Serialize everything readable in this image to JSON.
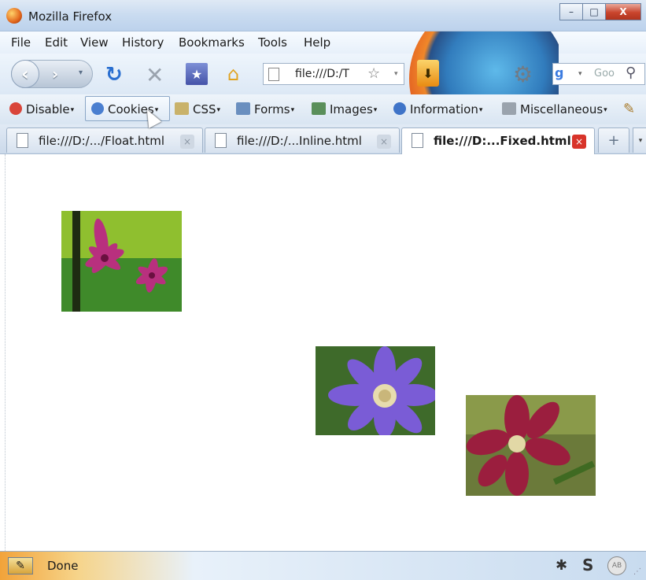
{
  "window": {
    "title": "Mozilla Firefox",
    "minimize": "–",
    "maximize": "□",
    "close": "X"
  },
  "menu": {
    "items": [
      "File",
      "Edit",
      "View",
      "History",
      "Bookmarks",
      "Tools",
      "Help"
    ]
  },
  "nav": {
    "back": "‹",
    "forward": "›",
    "dropdown": "▾",
    "reload": "↻",
    "stop": "✕",
    "bookmark": "★",
    "home": "⌂",
    "url": "file:///D:/T",
    "url_star": "☆",
    "url_drop": "▾",
    "download": "⬇",
    "settings": "⚙",
    "search_engine": "g",
    "search_drop": "▾",
    "search_placeholder": "Goo",
    "search_go": "⚲"
  },
  "devtoolbar": {
    "items": [
      {
        "label": "Disable",
        "color": "#d9453a"
      },
      {
        "label": "Cookies",
        "color": "#4a7fd0"
      },
      {
        "label": "CSS",
        "color": "#c9b26a"
      },
      {
        "label": "Forms",
        "color": "#6a8fbf"
      },
      {
        "label": "Images",
        "color": "#5a8f5a"
      },
      {
        "label": "Information",
        "color": "#3f74c8"
      },
      {
        "label": "Miscellaneous",
        "color": "#9aa3ad"
      }
    ],
    "arrow": "▾",
    "pen": "✎"
  },
  "tabs": [
    {
      "label": "file:///D:/.../Float.html",
      "active": false
    },
    {
      "label": "file:///D:/...Inline.html",
      "active": false
    },
    {
      "label": "file:///D:...Fixed.html",
      "active": true
    }
  ],
  "tab_close": "×",
  "new_tab": "+",
  "tab_list": "▾",
  "status": {
    "icon": "✎",
    "text": "Done",
    "bug": "✱",
    "s": "S",
    "adblock": "AB",
    "grip": "⋰"
  },
  "colors": {
    "pink_flower": "#b8307e",
    "purple_flower": "#7a5cd6",
    "red_flower": "#9b1e3e",
    "leaf_green": "#3f8a2a"
  }
}
